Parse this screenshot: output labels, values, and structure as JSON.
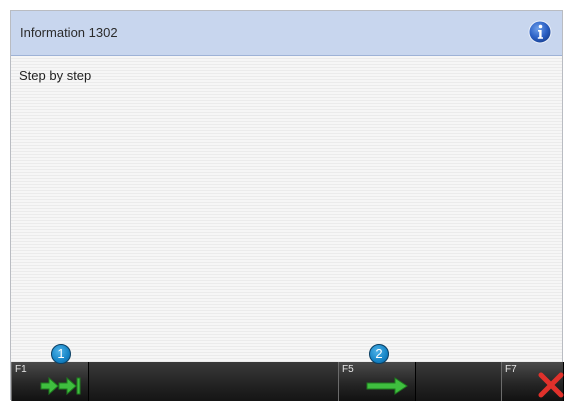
{
  "window": {
    "title": "Information 1302",
    "info_icon": "info-icon"
  },
  "content": {
    "message": "Step by step"
  },
  "function_keys": [
    {
      "key": "F1",
      "icon": "step-forward-arrows-icon",
      "badge": "1"
    },
    {
      "key": "F5",
      "icon": "arrow-right-icon",
      "badge": "2"
    },
    {
      "key": "F7",
      "icon": "close-icon"
    }
  ],
  "colors": {
    "title_bar": "#c8d6ee",
    "badge": "#1584c6",
    "arrow_green": "#3fbf3f",
    "close_red": "#e0312b"
  }
}
